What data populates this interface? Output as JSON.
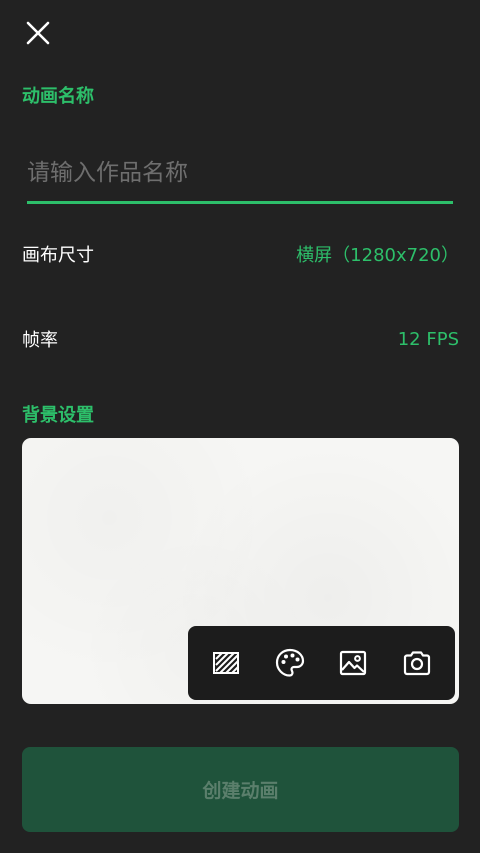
{
  "header": {
    "close_icon": "close-icon"
  },
  "name_section": {
    "label": "动画名称",
    "placeholder": "请输入作品名称",
    "value": ""
  },
  "canvas_size": {
    "label": "画布尺寸",
    "value": "横屏（1280x720）"
  },
  "frame_rate": {
    "label": "帧率",
    "value": "12 FPS"
  },
  "background": {
    "label": "背景设置",
    "toolbar": [
      {
        "icon": "transparent-pattern-icon"
      },
      {
        "icon": "palette-icon"
      },
      {
        "icon": "image-icon"
      },
      {
        "icon": "camera-icon"
      }
    ]
  },
  "create_button": {
    "label": "创建动画",
    "enabled": false
  },
  "colors": {
    "background": "#222222",
    "accent": "#2dbf6a",
    "button_disabled_bg": "#1f533b",
    "button_disabled_text": "#5b7f6c",
    "preview_bg": "#f6f6f4"
  }
}
